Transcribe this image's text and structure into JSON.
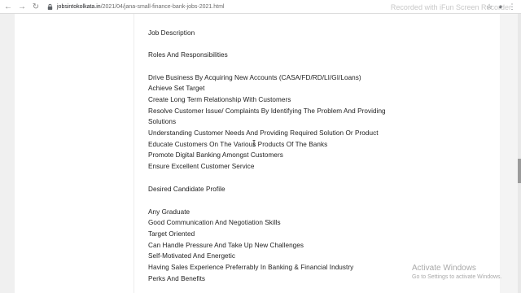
{
  "browser": {
    "url_domain": "jobsintokolkata.in",
    "url_path": "/2021/04/jana-small-finance-bank-jobs-2021.html",
    "recorder_watermark": "Recorded with iFun Screen Recorder"
  },
  "article": {
    "job_description_heading": "Job Description",
    "roles_heading": "Roles And Responsibilities",
    "roles": [
      "Drive Business By Acquiring New Accounts (CASA/FD/RD/LI/GI/Loans)",
      "Achieve Set Target",
      "Create Long Term Relationship With Customers",
      "Resolve Customer Issue/ Complaints By Identifying The Problem And Providing",
      "Solutions",
      "Understanding Customer Needs And Providing Required Solution Or Product",
      "Educate Customers On The Various Products Of The Banks",
      "Promote Digital Banking Amongst Customers",
      "Ensure Excellent Customer Service"
    ],
    "profile_heading": "Desired Candidate Profile",
    "profile": [
      "Any Graduate",
      "Good Communication And Negotiation Skills",
      "Target Oriented",
      "Can Handle Pressure And Take Up New Challenges",
      "Self-Motivated And Energetic",
      "Having Sales Experience Preferrably In Banking & Financial Industry"
    ],
    "perks_heading": "Perks And Benefits"
  },
  "windows_activation": {
    "title": "Activate Windows",
    "subtitle": "Go to Settings to activate Windows."
  }
}
